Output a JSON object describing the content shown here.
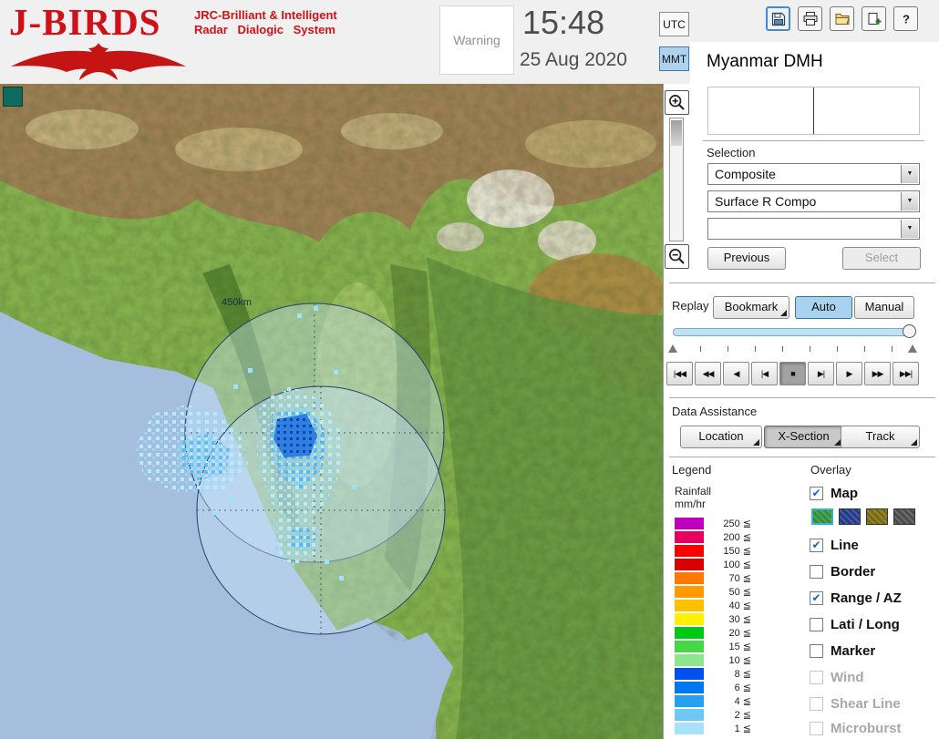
{
  "header": {
    "logo_title": "J-BIRDS",
    "logo_tagline1": "JRC-Brilliant & Intelligent",
    "logo_tagline2": "Radar Dialogic System",
    "warning_label": "Warning",
    "time": "15:48",
    "date": "25 Aug 2020",
    "tz_options": [
      {
        "label": "UTC",
        "selected": false
      },
      {
        "label": "MMT",
        "selected": true
      }
    ],
    "toolbar": [
      {
        "icon": "save"
      },
      {
        "icon": "print"
      },
      {
        "icon": "open-folder"
      },
      {
        "icon": "new-window"
      },
      {
        "icon": "help"
      }
    ],
    "station_name": "Myanmar DMH"
  },
  "map": {
    "range_label": "450km"
  },
  "selection": {
    "label": "Selection",
    "dropdowns": [
      {
        "value": "Composite"
      },
      {
        "value": "Surface R Compo"
      },
      {
        "value": ""
      }
    ],
    "previous_label": "Previous",
    "select_label": "Select"
  },
  "replay": {
    "label": "Replay",
    "bookmark_label": "Bookmark",
    "auto_label": "Auto",
    "manual_label": "Manual",
    "active_mode": "Auto",
    "tick_count": 8,
    "progress": 1
  },
  "playback": {
    "buttons": [
      {
        "name": "skip-to-start",
        "glyph": "|◀◀",
        "active": false
      },
      {
        "name": "fast-backward",
        "glyph": "◀◀",
        "active": false
      },
      {
        "name": "play-backward",
        "glyph": "◀",
        "active": false
      },
      {
        "name": "step-backward",
        "glyph": "|◀",
        "active": false
      },
      {
        "name": "stop",
        "glyph": "■",
        "active": true
      },
      {
        "name": "step-forward",
        "glyph": "▶|",
        "active": false
      },
      {
        "name": "play-forward",
        "glyph": "▶",
        "active": false
      },
      {
        "name": "fast-forward",
        "glyph": "▶▶",
        "active": false
      },
      {
        "name": "skip-to-end",
        "glyph": "▶▶|",
        "active": false
      }
    ]
  },
  "data_assistance": {
    "label": "Data Assistance",
    "buttons": [
      {
        "label": "Location",
        "active": false
      },
      {
        "label": "X-Section",
        "active": true
      },
      {
        "label": "Track",
        "active": false
      }
    ]
  },
  "legend": {
    "title": "Legend",
    "series": "Rainfall",
    "unit": "mm/hr",
    "lte_symbol": "≦",
    "entries": [
      {
        "value": 250,
        "color": "#be00be"
      },
      {
        "value": 200,
        "color": "#e60060"
      },
      {
        "value": 150,
        "color": "#ff0000"
      },
      {
        "value": 100,
        "color": "#d80000"
      },
      {
        "value": 70,
        "color": "#ff7800"
      },
      {
        "value": 50,
        "color": "#ff9b00"
      },
      {
        "value": 40,
        "color": "#ffc000"
      },
      {
        "value": 30,
        "color": "#fff000"
      },
      {
        "value": 20,
        "color": "#00c814"
      },
      {
        "value": 15,
        "color": "#46d746"
      },
      {
        "value": 10,
        "color": "#8ce68c"
      },
      {
        "value": 8,
        "color": "#0050f0"
      },
      {
        "value": 6,
        "color": "#0078f0"
      },
      {
        "value": 4,
        "color": "#28a0f0"
      },
      {
        "value": 2,
        "color": "#6ec8f5"
      },
      {
        "value": 1,
        "color": "#aae1fa"
      }
    ]
  },
  "overlay": {
    "title": "Overlay",
    "items": [
      {
        "label": "Map",
        "checked": true,
        "disabled": false
      },
      {
        "label": "Line",
        "checked": true,
        "disabled": false
      },
      {
        "label": "Border",
        "checked": false,
        "disabled": false
      },
      {
        "label": "Range / AZ",
        "checked": true,
        "disabled": false
      },
      {
        "label": "Lati / Long",
        "checked": false,
        "disabled": false
      },
      {
        "label": "Marker",
        "checked": false,
        "disabled": false
      },
      {
        "label": "Wind",
        "checked": false,
        "disabled": true
      },
      {
        "label": "Shear Line",
        "checked": false,
        "disabled": true
      },
      {
        "label": "Microburst",
        "checked": false,
        "disabled": true
      }
    ],
    "map_styles": [
      {
        "color": "#2e8f3c",
        "selected": true
      },
      {
        "color": "#233a8c",
        "selected": false
      },
      {
        "color": "#7a6a10",
        "selected": false
      },
      {
        "color": "#4c4c4c",
        "selected": false
      }
    ]
  }
}
